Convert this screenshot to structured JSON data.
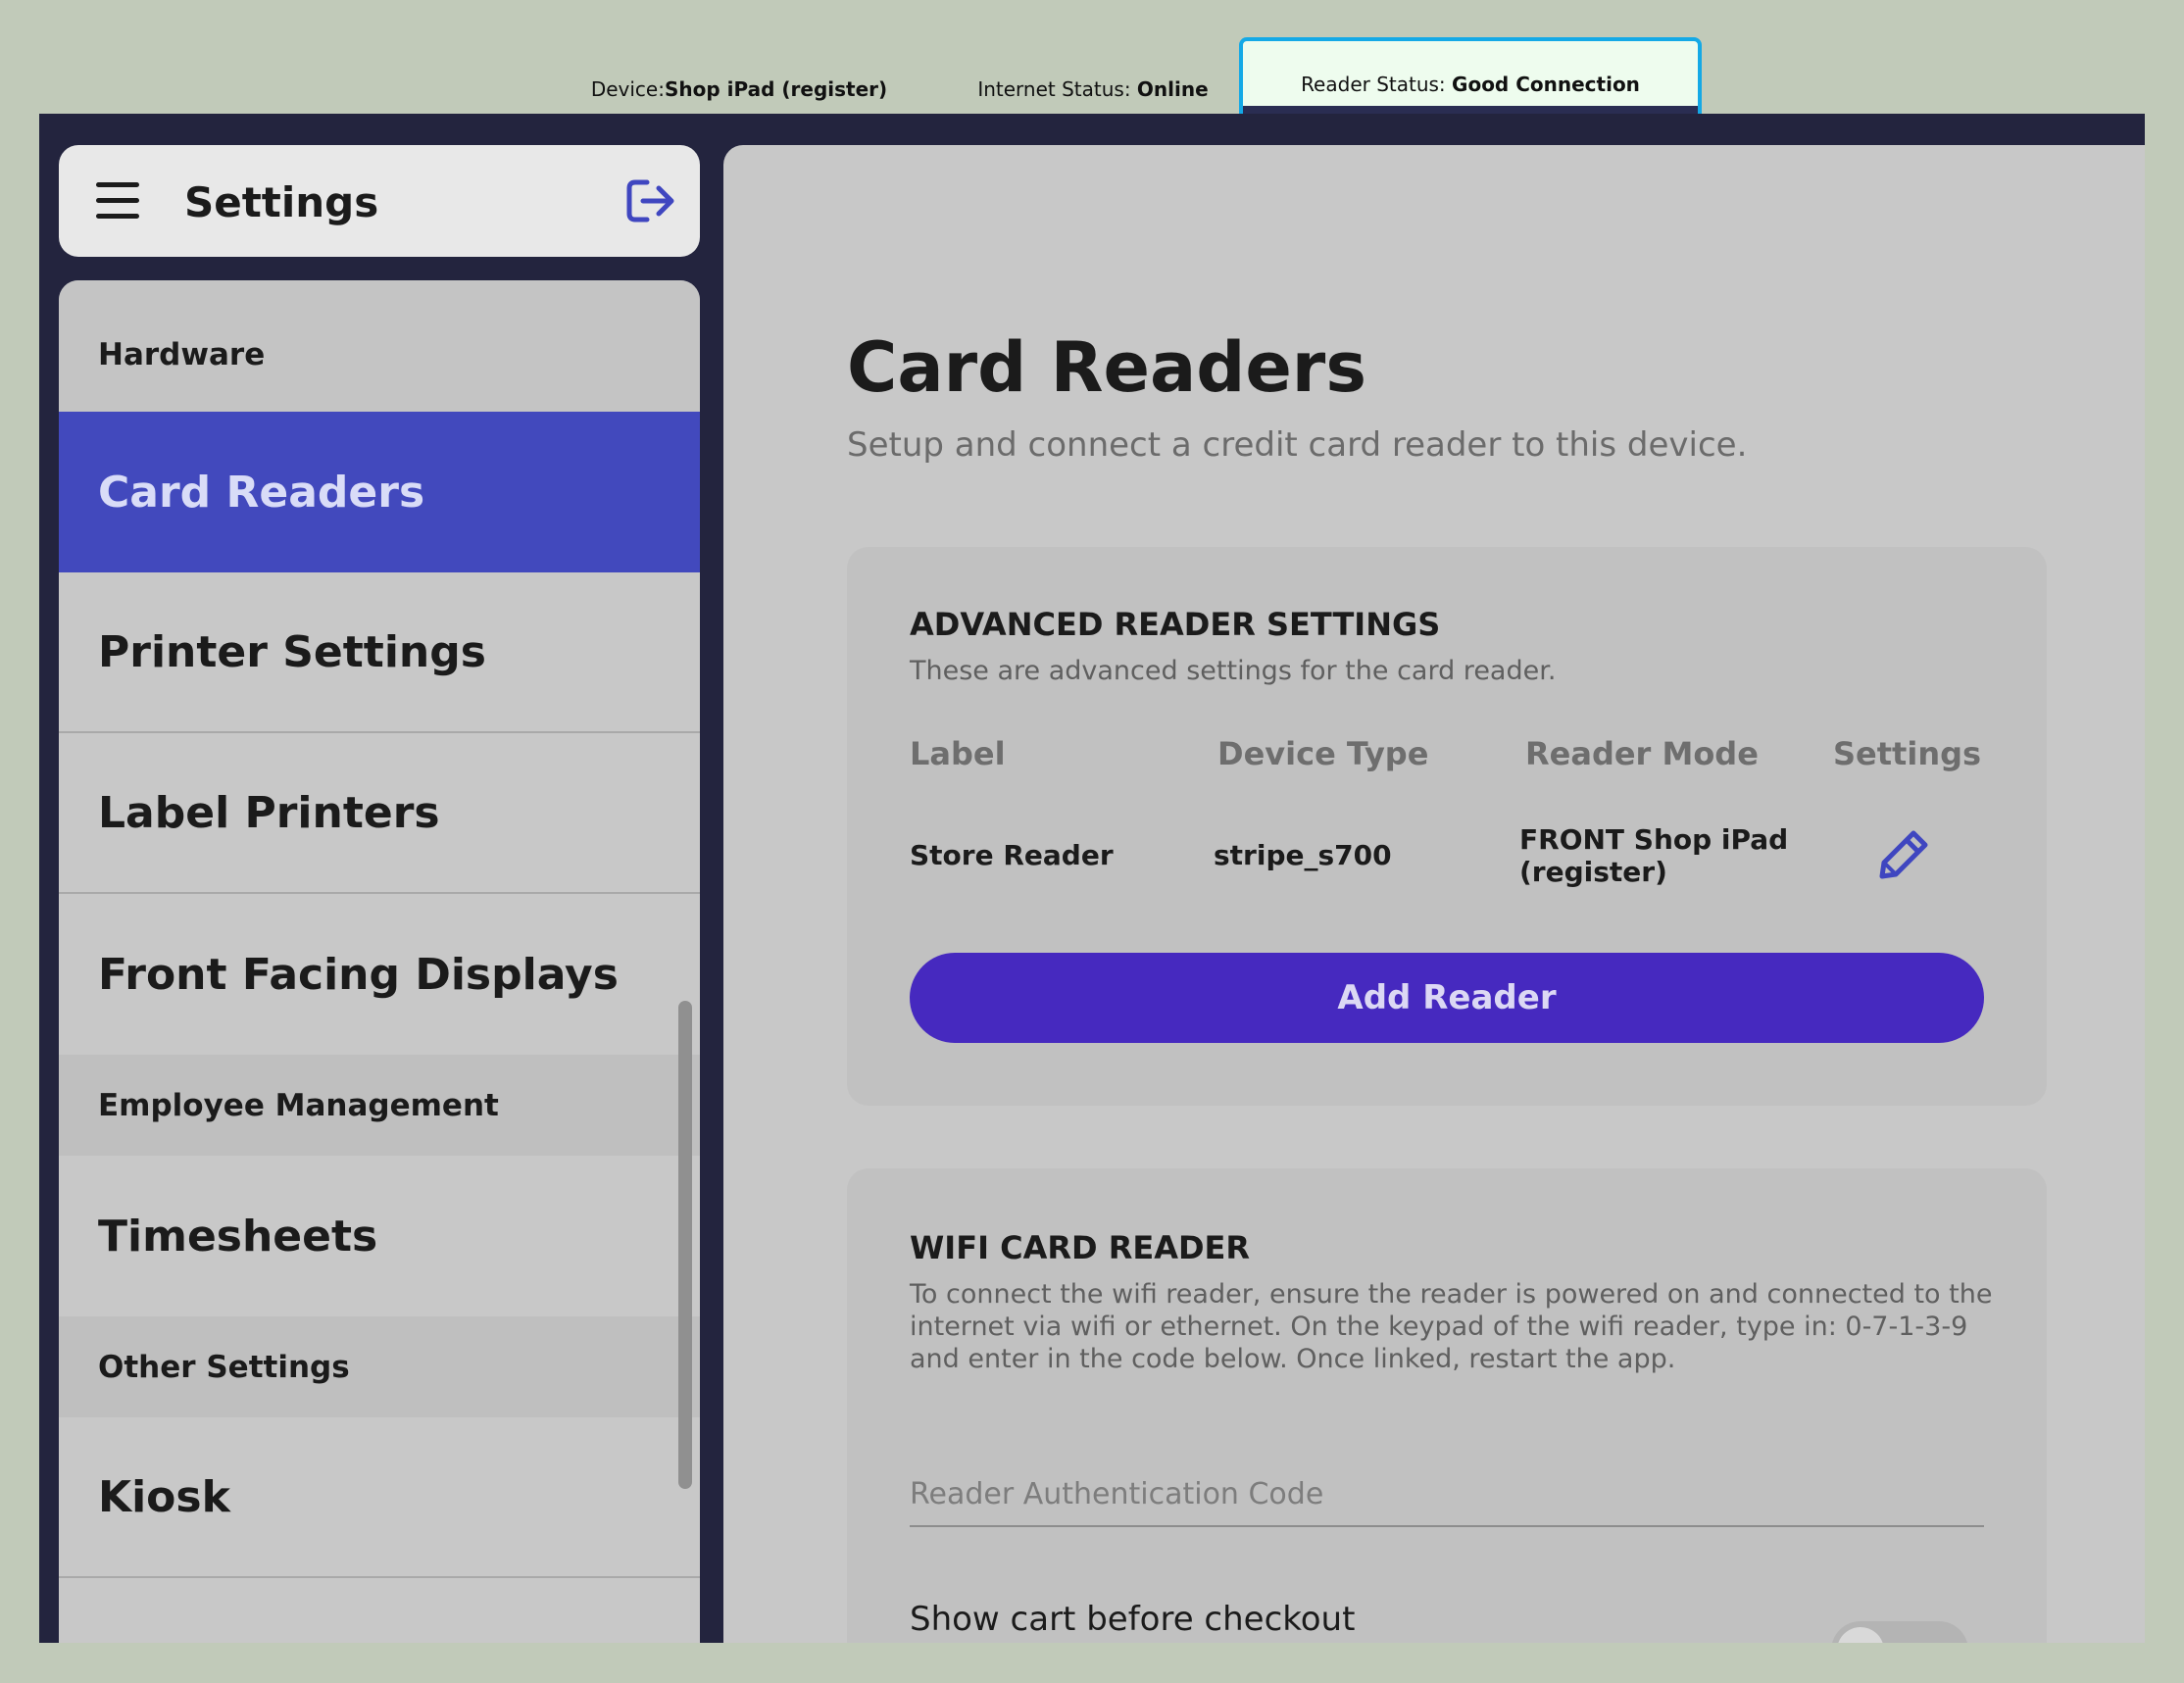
{
  "status_bar": {
    "device_label": "Device:",
    "device_value": "Shop iPad (register)",
    "internet_label": "Internet Status:",
    "internet_value": "Online",
    "reader_label": "Reader Status:",
    "reader_value": "Good Connection"
  },
  "sidebar": {
    "title": "Settings",
    "sections": {
      "hardware": "Hardware",
      "employee": "Employee Management",
      "other": "Other Settings"
    },
    "items": {
      "card_readers": "Card Readers",
      "printer_settings": "Printer Settings",
      "label_printers": "Label Printers",
      "front_facing_displays": "Front Facing Displays",
      "timesheets": "Timesheets",
      "kiosk": "Kiosk"
    }
  },
  "main": {
    "title": "Card Readers",
    "subtitle": "Setup and connect a credit card reader to this device.",
    "advanced": {
      "title": "ADVANCED READER SETTINGS",
      "description": "These are advanced settings for the card reader.",
      "columns": [
        "Label",
        "Device Type",
        "Reader Mode",
        "Settings"
      ],
      "row": {
        "label": "Store Reader",
        "device_type": "stripe_s700",
        "reader_mode_line1": "FRONT Shop iPad",
        "reader_mode_line2": "(register)"
      },
      "add_button": "Add Reader"
    },
    "wifi": {
      "title": "WIFI CARD READER",
      "description": "To connect the wifi reader, ensure the reader is powered on and connected to the internet via wifi or ethernet. On the keypad of the wifi reader, type in: 0-7-1-3-9 and enter in the code below. Once linked, restart the app.",
      "auth_placeholder": "Reader Authentication Code",
      "toggle_label": "Show cart before checkout"
    }
  },
  "colors": {
    "accent": "#4249bd",
    "button": "#4629bf",
    "frame": "#23243e",
    "status_highlight": "#14a9e6"
  }
}
